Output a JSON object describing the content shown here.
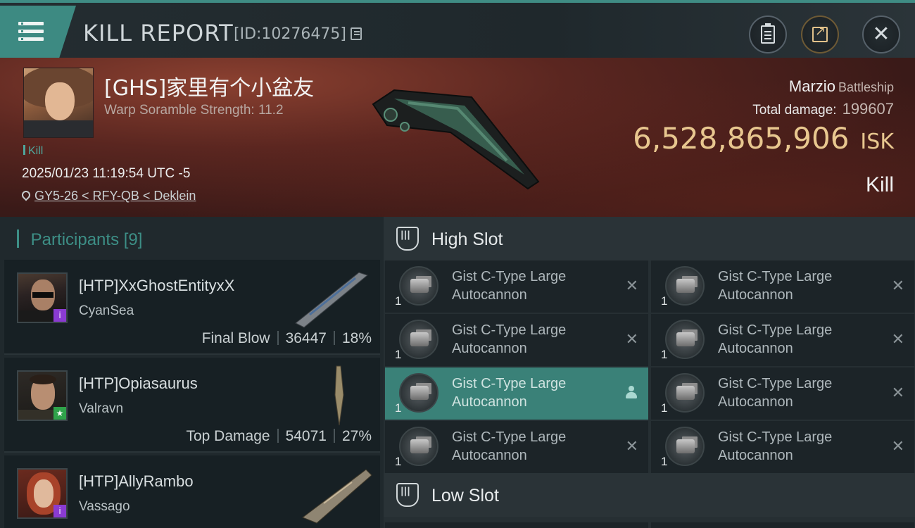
{
  "header": {
    "title": "KILL REPORT",
    "report_id": "[ID:10276475]"
  },
  "victim": {
    "name": "[GHS]家里有个小盆友",
    "warp_scramble": "Warp Soramble Strength: 11.2",
    "tag": "Kill",
    "datetime": "2025/01/23 11:19:54 UTC -5",
    "location": "GY5-26 < RFY-QB < Deklein",
    "ship_name": "Marzio",
    "ship_class": "Battleship",
    "total_damage_label": "Total damage:",
    "total_damage": "199607",
    "isk_value": "6,528,865,906",
    "isk_unit": "ISK",
    "result": "Kill"
  },
  "participants": {
    "label": "Participants",
    "count": "[9]",
    "rows": [
      {
        "name": "[HTP]XxGhostEntityxX",
        "corp": "CyanSea",
        "role": "Final Blow",
        "damage": "36447",
        "pct": "18%",
        "badge": "i",
        "badge_color": "#8a3bd1"
      },
      {
        "name": "[HTP]Opiasaurus",
        "corp": "Valravn",
        "role": "Top Damage",
        "damage": "54071",
        "pct": "27%",
        "badge": "★",
        "badge_color": "#2fa34a"
      },
      {
        "name": "[HTP]AllyRambo",
        "corp": "Vassago",
        "role": "",
        "damage": "",
        "pct": "",
        "badge": "i",
        "badge_color": "#8a3bd1"
      }
    ]
  },
  "slots": {
    "high_label": "High Slot",
    "low_label": "Low Slot",
    "high": [
      {
        "name": "Gist C-Type Large Autocannon",
        "qty": "1",
        "status": "destroyed"
      },
      {
        "name": "Gist C-Type Large Autocannon",
        "qty": "1",
        "status": "destroyed"
      },
      {
        "name": "Gist C-Type Large Autocannon",
        "qty": "1",
        "status": "destroyed"
      },
      {
        "name": "Gist C-Type Large Autocannon",
        "qty": "1",
        "status": "destroyed"
      },
      {
        "name": "Gist C-Type Large Autocannon",
        "qty": "1",
        "status": "dropped"
      },
      {
        "name": "Gist C-Type Large Autocannon",
        "qty": "1",
        "status": "destroyed"
      },
      {
        "name": "Gist C-Type Large Autocannon",
        "qty": "1",
        "status": "destroyed"
      },
      {
        "name": "Gist C-Type Large Autocannon",
        "qty": "1",
        "status": "destroyed"
      }
    ]
  },
  "colors": {
    "accent": "#3d8a82",
    "isk": "#e8c78f",
    "active_row": "#3a8178"
  }
}
